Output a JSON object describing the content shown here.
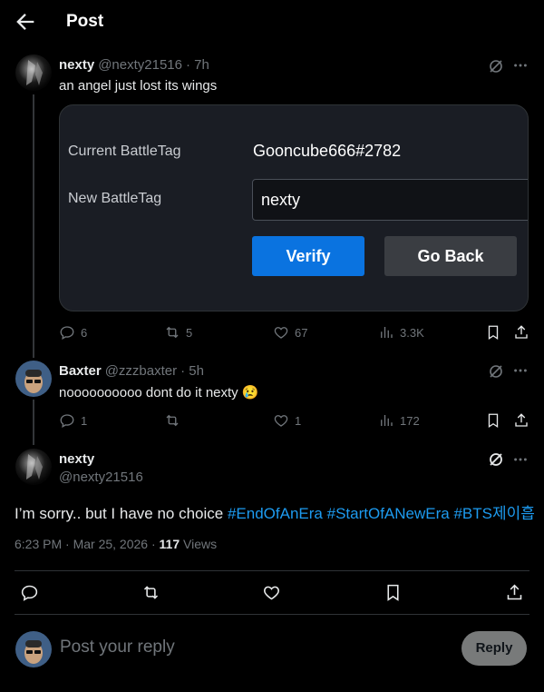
{
  "header": {
    "title": "Post"
  },
  "reply_post": {
    "author_name": "nexty",
    "author_handle": "@nexty21516",
    "dot_time": "· 7h",
    "text": "an angel just lost its wings",
    "card": {
      "current_label": "Current BattleTag",
      "current_value": "Gooncube666#2782",
      "new_label": "New BattleTag",
      "new_value": "nexty",
      "verify_label": "Verify",
      "goback_label": "Go Back"
    },
    "stats": {
      "replies": "6",
      "reposts": "5",
      "likes": "67",
      "views": "3.3K"
    }
  },
  "second_post": {
    "author_name": "Baxter",
    "author_handle": "@zzzbaxter",
    "dot_time": "· 5h",
    "text": "noooooooooo dont do it nexty 😢",
    "stats": {
      "replies": "1",
      "reposts": "",
      "likes": "1",
      "views": "172"
    }
  },
  "main_post": {
    "author_name": "nexty",
    "author_handle": "@nexty21516",
    "text_plain": "I’m sorry.. but I have no choice ",
    "hashtags": [
      "#EndOfAnEra",
      "#StartOfANewEra",
      "#BTS제이흡"
    ],
    "time": "6:23 PM · Mar 25, 2026 · ",
    "views_count": "117",
    "views_label": " Views"
  },
  "composer": {
    "placeholder": "Post your reply",
    "reply_label": "Reply"
  },
  "colors": {
    "accent": "#1d9bf0",
    "background": "#000000",
    "muted": "#71767b"
  }
}
